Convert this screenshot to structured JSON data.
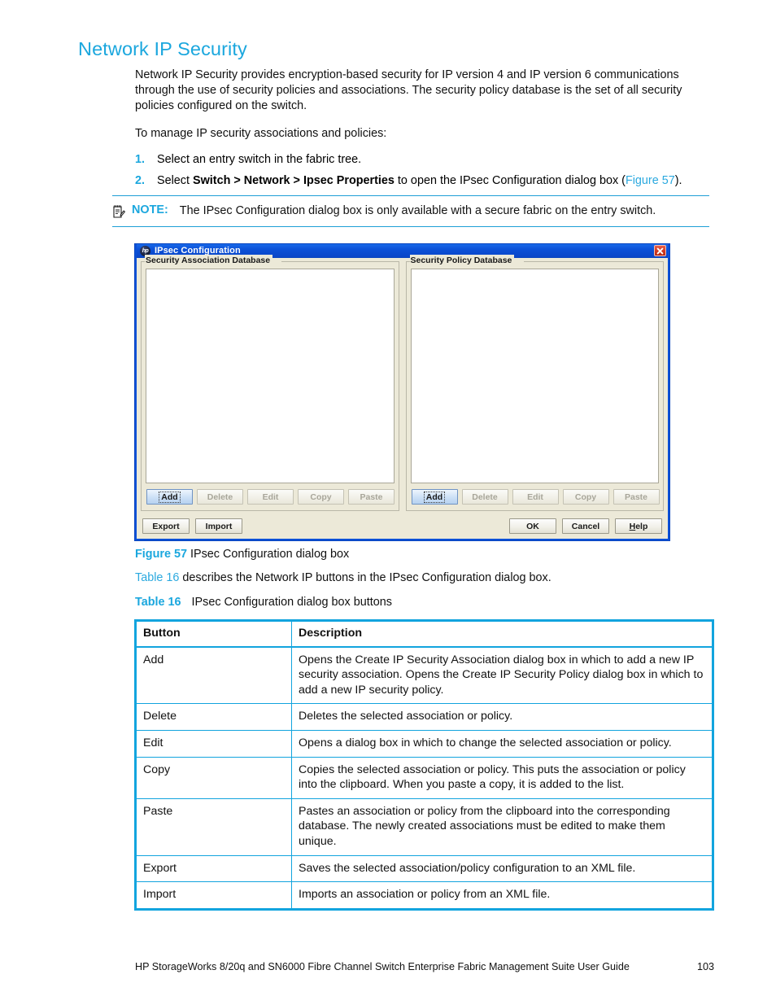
{
  "page": {
    "heading": "Network IP Security",
    "paragraphs": [
      "Network IP Security provides encryption-based security for IP version 4 and IP version 6 communications through the use of security policies and associations. The security policy database is the set of all security policies configured on the switch.",
      "To manage IP security associations and policies:"
    ],
    "steps": [
      {
        "num": "1.",
        "prefix": "Select an entry switch in the fabric tree.",
        "bold": "",
        "middle": "",
        "xref": "",
        "suffix": ""
      },
      {
        "num": "2.",
        "prefix": "Select ",
        "bold": "Switch > Network > Ipsec Properties",
        "middle": " to open the IPsec Configuration dialog box (",
        "xref": "Figure 57",
        "suffix": ")."
      }
    ],
    "note": {
      "icon": "note-pad-icon",
      "label": "NOTE:",
      "text": "The IPsec Configuration dialog box is only available with a secure fabric on the entry switch."
    }
  },
  "dialog": {
    "title": "IPsec Configuration",
    "logo_text": "hp",
    "close_icon": "close-icon",
    "panels": [
      {
        "title": "Security Association Database",
        "buttons": [
          {
            "label": "Add",
            "state": "focused"
          },
          {
            "label": "Delete",
            "state": "disabled"
          },
          {
            "label": "Edit",
            "state": "disabled"
          },
          {
            "label": "Copy",
            "state": "disabled"
          },
          {
            "label": "Paste",
            "state": "disabled"
          }
        ]
      },
      {
        "title": "Security Policy Database",
        "buttons": [
          {
            "label": "Add",
            "state": "focused"
          },
          {
            "label": "Delete",
            "state": "disabled"
          },
          {
            "label": "Edit",
            "state": "disabled"
          },
          {
            "label": "Copy",
            "state": "disabled"
          },
          {
            "label": "Paste",
            "state": "disabled"
          }
        ]
      }
    ],
    "footer_left": [
      {
        "label": "Export"
      },
      {
        "label": "Import"
      }
    ],
    "footer_right": [
      {
        "label": "OK"
      },
      {
        "label": "Cancel"
      },
      {
        "label": "Help"
      }
    ]
  },
  "figure": {
    "label": "Figure 57",
    "caption": "IPsec Configuration dialog box"
  },
  "table_intro": {
    "xref": "Table 16",
    "text": " describes the Network IP buttons in the IPsec Configuration dialog box."
  },
  "table_caption": {
    "label": "Table 16",
    "text": "IPsec Configuration dialog box buttons"
  },
  "table": {
    "headers": [
      "Button",
      "Description"
    ],
    "rows": [
      [
        "Add",
        "Opens the Create IP Security Association dialog box in which to add a new IP security association. Opens the Create IP Security Policy dialog box in which to add a new IP security policy."
      ],
      [
        "Delete",
        "Deletes the selected association or policy."
      ],
      [
        "Edit",
        "Opens a dialog box in which to change the selected association or policy."
      ],
      [
        "Copy",
        "Copies the selected association or policy. This puts the association or policy into the clipboard. When you paste a copy, it is added to the list."
      ],
      [
        "Paste",
        "Pastes an association or policy from the clipboard into the corresponding database. The newly created associations must be edited to make them unique."
      ],
      [
        "Export",
        "Saves the selected association/policy configuration to an XML file."
      ],
      [
        "Import",
        "Imports an association or policy from an XML file."
      ]
    ]
  },
  "footer": {
    "text": "HP StorageWorks 8/20q and SN6000 Fibre Channel Switch Enterprise Fabric Management Suite User Guide",
    "page_number": "103"
  },
  "colors": {
    "accent": "#1BA7DE",
    "table_border": "#12A4DE",
    "titlebar": "#0b4fd6",
    "close_red": "#d33a22"
  }
}
